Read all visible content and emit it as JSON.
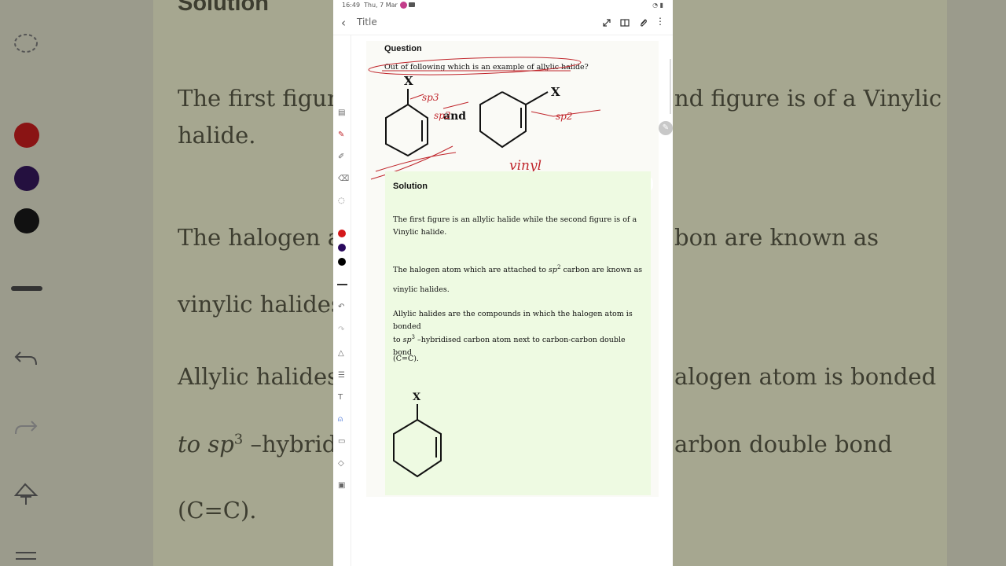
{
  "background": {
    "heading_fragment": "Solution",
    "lines": [
      "The first figure",
      "nd figure is of a Vinylic",
      "halide.",
      "The halogen ato",
      "bon are known as",
      "vinylic halides.",
      "Allylic halides a",
      "alogen atom is bonded",
      "to sp",
      "–hybridi",
      "arbon double bond",
      "(C=C)."
    ],
    "sup3": "3"
  },
  "status_bar": {
    "time": "16:49",
    "date": "Thu, 7 Mar"
  },
  "top_bar": {
    "back_icon": "chevron-left-icon",
    "title": "Title"
  },
  "question": {
    "label": "Question",
    "text": "Out of following which is an example of allylic halide?",
    "and_label": "and",
    "x_label_1": "X",
    "x_label_2": "X",
    "annot_sp3": "sp3",
    "annot_sp2_a": "sp2",
    "annot_sp2_b": "sp2",
    "annot_vinyl": "vinyl"
  },
  "solution": {
    "label": "Solution",
    "p1": "The first figure is an allylic halide while the second figure is of a Vinylic halide.",
    "p2_pre": "The halogen atom which are attached to ",
    "p2_sp": "sp",
    "p2_sup": "2",
    "p2_post": " carbon are known as",
    "p3": "vinylic halides.",
    "p4": "Allylic halides are the compounds in which the halogen atom is bonded",
    "p5_pre": "to ",
    "p5_sp": "sp",
    "p5_sup": "3",
    "p5_post": " –hybridised carbon atom next to carbon-carbon double bond",
    "p6": "(C=C).",
    "x_label": "X"
  },
  "colors": {
    "red": "#d4191b",
    "purple": "#2a0a5e",
    "black": "#000000",
    "solution_bg": "#eefae2",
    "ink": "#c0262c"
  }
}
